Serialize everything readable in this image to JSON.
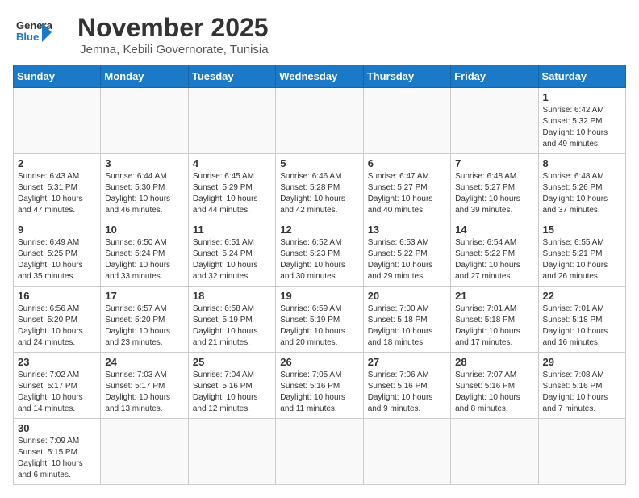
{
  "logo": {
    "text_general": "General",
    "text_blue": "Blue"
  },
  "header": {
    "month": "November 2025",
    "location": "Jemna, Kebili Governorate, Tunisia"
  },
  "weekdays": [
    "Sunday",
    "Monday",
    "Tuesday",
    "Wednesday",
    "Thursday",
    "Friday",
    "Saturday"
  ],
  "days": [
    {
      "num": "",
      "info": ""
    },
    {
      "num": "",
      "info": ""
    },
    {
      "num": "",
      "info": ""
    },
    {
      "num": "",
      "info": ""
    },
    {
      "num": "",
      "info": ""
    },
    {
      "num": "",
      "info": ""
    },
    {
      "num": "1",
      "info": "Sunrise: 6:42 AM\nSunset: 5:32 PM\nDaylight: 10 hours and 49 minutes."
    },
    {
      "num": "2",
      "info": "Sunrise: 6:43 AM\nSunset: 5:31 PM\nDaylight: 10 hours and 47 minutes."
    },
    {
      "num": "3",
      "info": "Sunrise: 6:44 AM\nSunset: 5:30 PM\nDaylight: 10 hours and 46 minutes."
    },
    {
      "num": "4",
      "info": "Sunrise: 6:45 AM\nSunset: 5:29 PM\nDaylight: 10 hours and 44 minutes."
    },
    {
      "num": "5",
      "info": "Sunrise: 6:46 AM\nSunset: 5:28 PM\nDaylight: 10 hours and 42 minutes."
    },
    {
      "num": "6",
      "info": "Sunrise: 6:47 AM\nSunset: 5:27 PM\nDaylight: 10 hours and 40 minutes."
    },
    {
      "num": "7",
      "info": "Sunrise: 6:48 AM\nSunset: 5:27 PM\nDaylight: 10 hours and 39 minutes."
    },
    {
      "num": "8",
      "info": "Sunrise: 6:48 AM\nSunset: 5:26 PM\nDaylight: 10 hours and 37 minutes."
    },
    {
      "num": "9",
      "info": "Sunrise: 6:49 AM\nSunset: 5:25 PM\nDaylight: 10 hours and 35 minutes."
    },
    {
      "num": "10",
      "info": "Sunrise: 6:50 AM\nSunset: 5:24 PM\nDaylight: 10 hours and 33 minutes."
    },
    {
      "num": "11",
      "info": "Sunrise: 6:51 AM\nSunset: 5:24 PM\nDaylight: 10 hours and 32 minutes."
    },
    {
      "num": "12",
      "info": "Sunrise: 6:52 AM\nSunset: 5:23 PM\nDaylight: 10 hours and 30 minutes."
    },
    {
      "num": "13",
      "info": "Sunrise: 6:53 AM\nSunset: 5:22 PM\nDaylight: 10 hours and 29 minutes."
    },
    {
      "num": "14",
      "info": "Sunrise: 6:54 AM\nSunset: 5:22 PM\nDaylight: 10 hours and 27 minutes."
    },
    {
      "num": "15",
      "info": "Sunrise: 6:55 AM\nSunset: 5:21 PM\nDaylight: 10 hours and 26 minutes."
    },
    {
      "num": "16",
      "info": "Sunrise: 6:56 AM\nSunset: 5:20 PM\nDaylight: 10 hours and 24 minutes."
    },
    {
      "num": "17",
      "info": "Sunrise: 6:57 AM\nSunset: 5:20 PM\nDaylight: 10 hours and 23 minutes."
    },
    {
      "num": "18",
      "info": "Sunrise: 6:58 AM\nSunset: 5:19 PM\nDaylight: 10 hours and 21 minutes."
    },
    {
      "num": "19",
      "info": "Sunrise: 6:59 AM\nSunset: 5:19 PM\nDaylight: 10 hours and 20 minutes."
    },
    {
      "num": "20",
      "info": "Sunrise: 7:00 AM\nSunset: 5:18 PM\nDaylight: 10 hours and 18 minutes."
    },
    {
      "num": "21",
      "info": "Sunrise: 7:01 AM\nSunset: 5:18 PM\nDaylight: 10 hours and 17 minutes."
    },
    {
      "num": "22",
      "info": "Sunrise: 7:01 AM\nSunset: 5:18 PM\nDaylight: 10 hours and 16 minutes."
    },
    {
      "num": "23",
      "info": "Sunrise: 7:02 AM\nSunset: 5:17 PM\nDaylight: 10 hours and 14 minutes."
    },
    {
      "num": "24",
      "info": "Sunrise: 7:03 AM\nSunset: 5:17 PM\nDaylight: 10 hours and 13 minutes."
    },
    {
      "num": "25",
      "info": "Sunrise: 7:04 AM\nSunset: 5:16 PM\nDaylight: 10 hours and 12 minutes."
    },
    {
      "num": "26",
      "info": "Sunrise: 7:05 AM\nSunset: 5:16 PM\nDaylight: 10 hours and 11 minutes."
    },
    {
      "num": "27",
      "info": "Sunrise: 7:06 AM\nSunset: 5:16 PM\nDaylight: 10 hours and 9 minutes."
    },
    {
      "num": "28",
      "info": "Sunrise: 7:07 AM\nSunset: 5:16 PM\nDaylight: 10 hours and 8 minutes."
    },
    {
      "num": "29",
      "info": "Sunrise: 7:08 AM\nSunset: 5:16 PM\nDaylight: 10 hours and 7 minutes."
    },
    {
      "num": "30",
      "info": "Sunrise: 7:09 AM\nSunset: 5:15 PM\nDaylight: 10 hours and 6 minutes."
    },
    {
      "num": "",
      "info": ""
    },
    {
      "num": "",
      "info": ""
    },
    {
      "num": "",
      "info": ""
    },
    {
      "num": "",
      "info": ""
    },
    {
      "num": "",
      "info": ""
    },
    {
      "num": "",
      "info": ""
    }
  ]
}
